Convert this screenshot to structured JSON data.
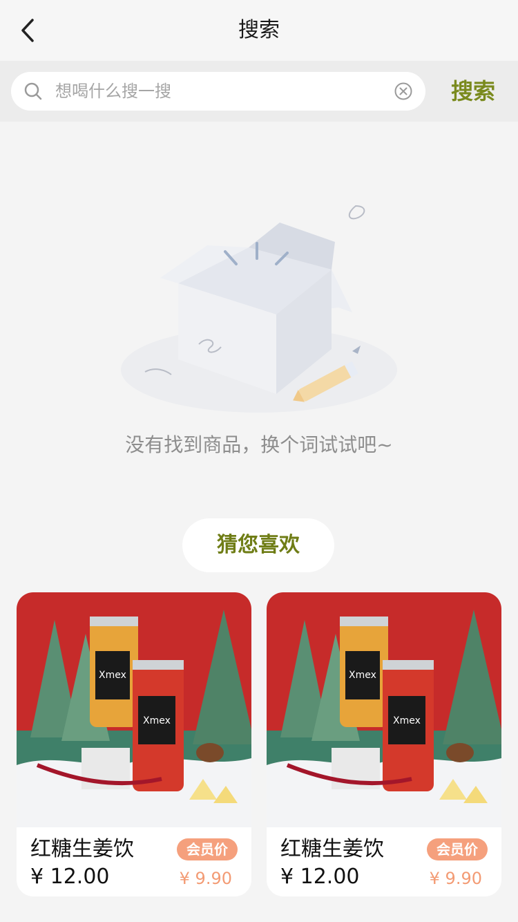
{
  "nav": {
    "title": "搜索"
  },
  "search": {
    "placeholder": "想喝什么搜一搜",
    "value": "",
    "button_label": "搜索"
  },
  "empty": {
    "message": "没有找到商品，换个词试试吧~"
  },
  "recommend": {
    "title": "猜您喜欢",
    "products": [
      {
        "name": "红糖生姜饮",
        "price": "¥ 12.00",
        "badge": "会员价",
        "member_price": "¥ 9.90",
        "brand_text": "Xmex"
      },
      {
        "name": "红糖生姜饮",
        "price": "¥ 12.00",
        "badge": "会员价",
        "member_price": "¥ 9.90",
        "brand_text": "Xmex"
      }
    ]
  },
  "colors": {
    "accent": "#7a8a1e",
    "badge_bg": "#f5a07d",
    "member_price": "#f39b74",
    "background": "#f4f4f4"
  },
  "icons": [
    "back-arrow-icon",
    "search-icon",
    "clear-icon"
  ]
}
